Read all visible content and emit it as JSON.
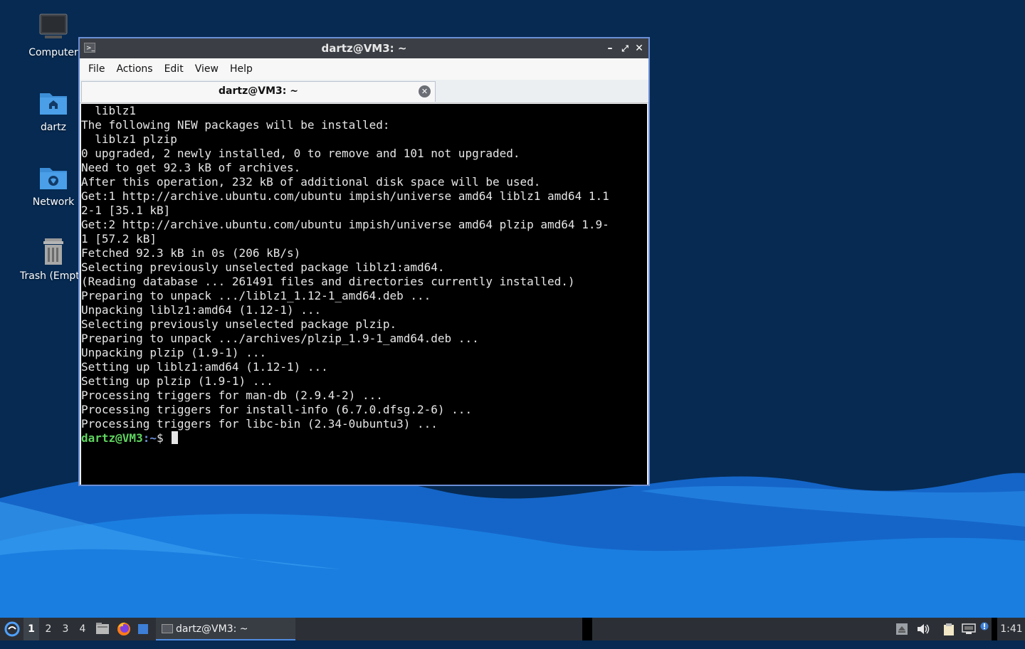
{
  "desktop": {
    "icons": [
      {
        "label": "Computer"
      },
      {
        "label": "dartz"
      },
      {
        "label": "Network"
      },
      {
        "label": "Trash (Empt"
      }
    ]
  },
  "window": {
    "title": "dartz@VM3: ~",
    "controls": {
      "minimize": "–",
      "maximize": "⤢",
      "close": "✕"
    },
    "menu": [
      "File",
      "Actions",
      "Edit",
      "View",
      "Help"
    ],
    "tab": {
      "title": "dartz@VM3: ~"
    }
  },
  "terminal": {
    "lines": [
      "  liblz1",
      "The following NEW packages will be installed:",
      "  liblz1 plzip",
      "0 upgraded, 2 newly installed, 0 to remove and 101 not upgraded.",
      "Need to get 92.3 kB of archives.",
      "After this operation, 232 kB of additional disk space will be used.",
      "Get:1 http://archive.ubuntu.com/ubuntu impish/universe amd64 liblz1 amd64 1.1",
      "2-1 [35.1 kB]",
      "Get:2 http://archive.ubuntu.com/ubuntu impish/universe amd64 plzip amd64 1.9-",
      "1 [57.2 kB]",
      "Fetched 92.3 kB in 0s (206 kB/s)",
      "Selecting previously unselected package liblz1:amd64.",
      "(Reading database ... 261491 files and directories currently installed.)",
      "Preparing to unpack .../liblz1_1.12-1_amd64.deb ...",
      "Unpacking liblz1:amd64 (1.12-1) ...",
      "Selecting previously unselected package plzip.",
      "Preparing to unpack .../archives/plzip_1.9-1_amd64.deb ...",
      "Unpacking plzip (1.9-1) ...",
      "Setting up liblz1:amd64 (1.12-1) ...",
      "Setting up plzip (1.9-1) ...",
      "Processing triggers for man-db (2.9.4-2) ...",
      "Processing triggers for install-info (6.7.0.dfsg.2-6) ...",
      "Processing triggers for libc-bin (2.34-0ubuntu3) ..."
    ],
    "prompt_user": "dartz@VM3",
    "prompt_path": ":~",
    "prompt_symbol": "$ "
  },
  "taskbar": {
    "workspaces": [
      "1",
      "2",
      "3",
      "4"
    ],
    "active_workspace": "1",
    "task_title": "dartz@VM3: ~",
    "clock": "1:41"
  },
  "colors": {
    "prompt_user": "#5fd35f",
    "prompt_path": "#6b8fd6",
    "window_border": "#6b8fd6",
    "desktop_bg": "#062a52"
  }
}
